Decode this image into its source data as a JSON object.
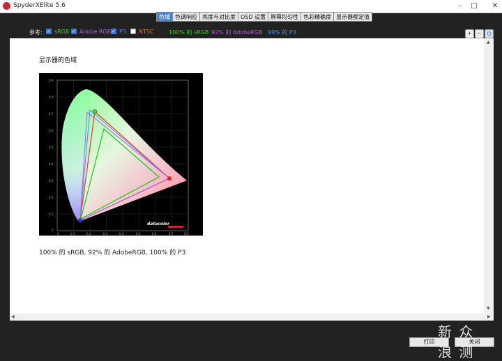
{
  "window": {
    "title": "SpyderXElite 5.6"
  },
  "tabs": [
    "色域",
    "色调响应",
    "亮度与对比度",
    "OSD 设置",
    "屏幕均匀性",
    "色彩精确度",
    "显示器额定值"
  ],
  "reference": {
    "label": "参考:",
    "options": [
      {
        "label": "sRGB",
        "checked": true,
        "color": "#39d339"
      },
      {
        "label": "Adobe RGB",
        "checked": true,
        "color": "#b45cd8"
      },
      {
        "label": "P3",
        "checked": true,
        "color": "#4c8fe0"
      },
      {
        "label": "NTSC",
        "checked": false,
        "color": "#e07b2a"
      }
    ],
    "results": [
      {
        "text": "100% 的 sRGB",
        "color": "#39d339"
      },
      {
        "text": "92% 的 AdobeRGB",
        "color": "#b45cd8"
      },
      {
        "text": "99% 的 P3",
        "color": "#4c8fe0"
      }
    ]
  },
  "content": {
    "heading": "显示器的色域",
    "caption": "100% 的 sRGB, 92% 的 AdobeRGB, 100% 的 P3",
    "plot_brand": "datacolor",
    "x_ticks": [
      "0",
      "0.1",
      "0.2",
      "0.3",
      "0.4",
      "0.5",
      "0.6",
      "0.7",
      "0.8"
    ],
    "y_ticks": [
      "0.9",
      "0.8",
      "0.7",
      "0.6",
      "0.5",
      "0.4",
      "0.3",
      "0.2",
      "0.1",
      "0"
    ]
  },
  "footer": {
    "print_label": "打印",
    "close_label": "关闭"
  },
  "watermark": "新 众\n浪 测"
}
